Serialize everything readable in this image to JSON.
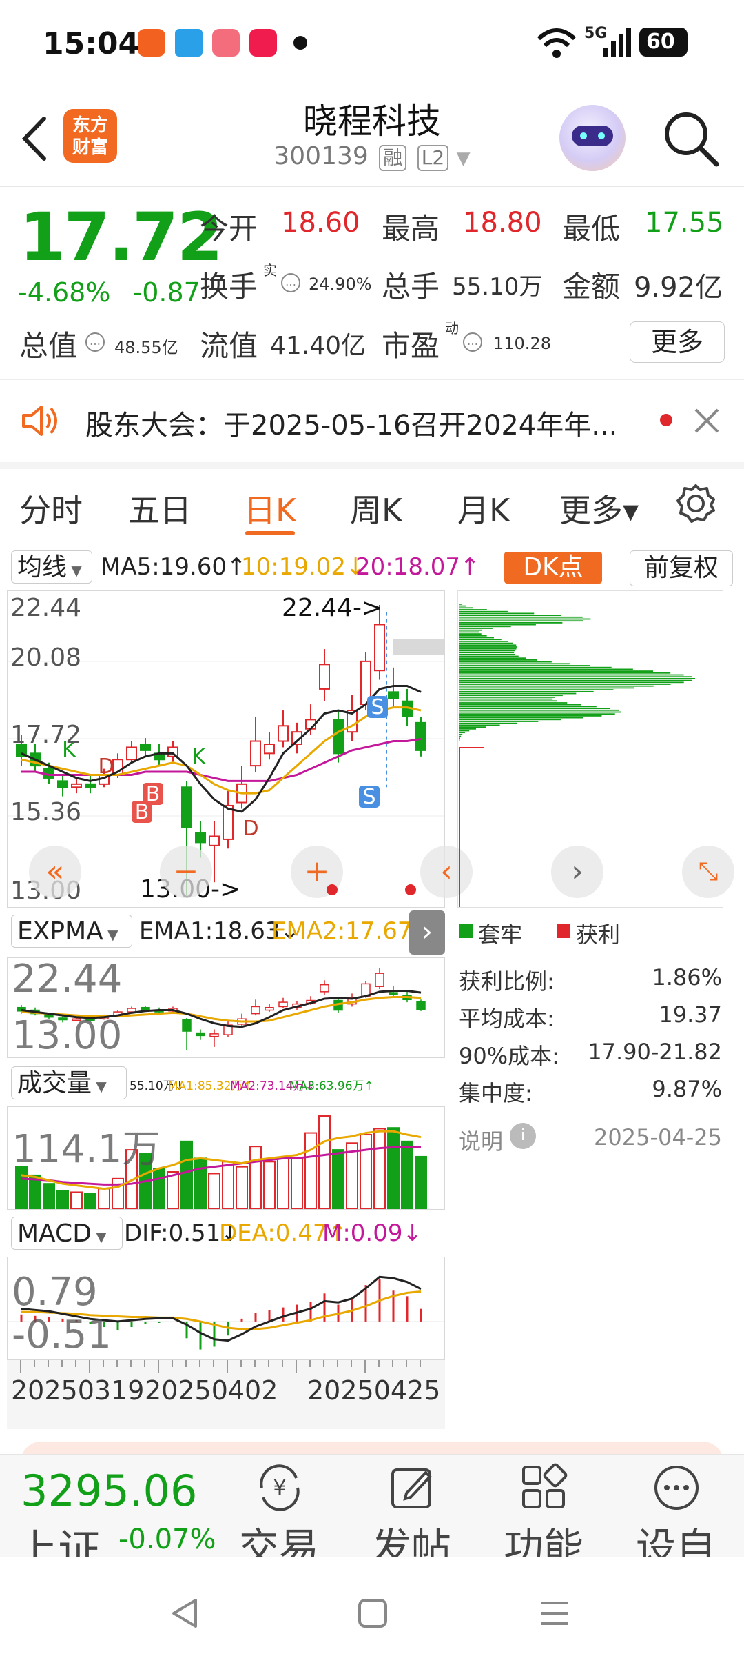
{
  "status_bar": {
    "time": "15:04",
    "battery": "60",
    "network": "5G"
  },
  "header": {
    "stock_name": "晓程科技",
    "stock_code": "300139",
    "tag_margin": "融",
    "tag_level": "L2",
    "logo_text_line1": "东方",
    "logo_text_line2": "财富"
  },
  "quote": {
    "price": "17.72",
    "change_pct": "-4.68%",
    "change_abs": "-0.87",
    "open_label": "今开",
    "open": "18.60",
    "high_label": "最高",
    "high": "18.80",
    "low_label": "最低",
    "low": "17.55",
    "turnover_label": "换手",
    "turnover_sup": "实",
    "turnover": "24.90%",
    "volume_label": "总手",
    "volume": "55.10万",
    "amount_label": "金额",
    "amount": "9.92亿",
    "total_value_label": "总值",
    "total_value": "48.55亿",
    "float_value_label": "流值",
    "float_value": "41.40亿",
    "pe_label": "市盈",
    "pe_sup": "动",
    "pe": "110.28",
    "more_label": "更多"
  },
  "notice": {
    "text": "股东大会：于2025-05-16召开2024年年..."
  },
  "tabs": [
    {
      "label": "分时"
    },
    {
      "label": "五日"
    },
    {
      "label": "日K"
    },
    {
      "label": "周K"
    },
    {
      "label": "月K"
    },
    {
      "label": "更多▾"
    }
  ],
  "kline": {
    "ma_selector": "均线",
    "ma5": "MA5:19.60↑",
    "ma10": "10:19.02↓",
    "ma20": "20:18.07↑",
    "dk_label": "DK点",
    "fq_label": "前复权",
    "y_labels": [
      "22.44",
      "20.08",
      "17.72",
      "15.36",
      "13.00"
    ],
    "high_marker": "22.44->",
    "low_marker": "13.00->",
    "signal_labels": [
      "D",
      "B",
      "B",
      "D",
      "K",
      "K",
      "S",
      "S"
    ]
  },
  "chip": {
    "legend_trapped": "套牢",
    "legend_profit": "获利",
    "rows": [
      {
        "label": "获利比例:",
        "value": "1.86%"
      },
      {
        "label": "平均成本:",
        "value": "19.37"
      },
      {
        "label": "90%成本:",
        "value": "17.90-21.82"
      },
      {
        "label": "集中度:",
        "value": "9.87%"
      }
    ],
    "note_label": "说明",
    "date": "2025-04-25"
  },
  "expma": {
    "selector": "EXPMA",
    "ema1": "EMA1:18.63↓",
    "ema2": "EMA2:17.67↑",
    "y_top": "22.44",
    "y_bottom": "13.00"
  },
  "volume": {
    "selector": "成交量",
    "vol": "55.10万↓",
    "ma1": "MA1:85.32万↑",
    "ma2": "MA2:73.14万↓",
    "ma3": "MA3:63.96万↑",
    "y_top": "114.1万"
  },
  "macd": {
    "selector": "MACD",
    "dif": "DIF:0.51↓",
    "dea": "DEA:0.47↑",
    "m": "M:0.09↓",
    "y_top": "0.79",
    "y_bottom": "-0.51"
  },
  "x_labels": [
    "20250319",
    "20250402",
    "20250425"
  ],
  "bottom_bar": {
    "index_value": "3295.06",
    "index_name": "上证",
    "index_change": "-0.07%",
    "items": [
      {
        "label": "交易"
      },
      {
        "label": "发帖"
      },
      {
        "label": "功能"
      },
      {
        "label": "设自"
      }
    ]
  },
  "colors": {
    "up": "#e0272b",
    "down": "#13a019",
    "accent": "#f16a21"
  }
}
